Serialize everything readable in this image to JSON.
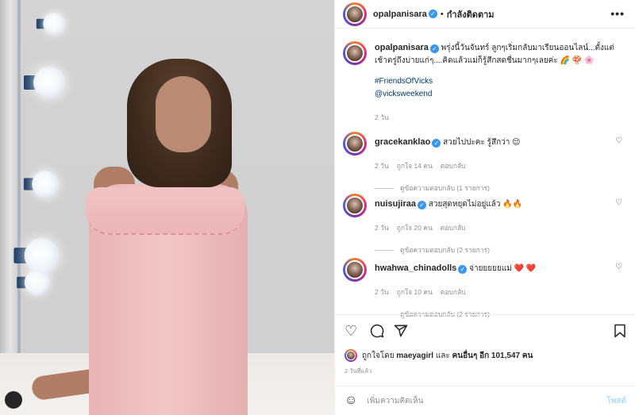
{
  "post": {
    "username": "opalpanisara",
    "follow_label": "กำลังติดตาม",
    "more_label": "•••"
  },
  "caption": {
    "username": "opalpanisara",
    "text": "พรุ่งนี้วันจันทร์ ลูกๆเริ่มกลับมาเรียนออนไลน์...ตั้งแต่เช้าตรู่ถึงบ่ายแก่ๆ....คิดแล้วแม่ก็รู้สึกสดชื่นมากๆเลยค่ะ 🌈 🍄 🌸",
    "hashtag": "#FriendsOfVicks",
    "mention": "@vicksweekend",
    "time": "2 วัน"
  },
  "comments": [
    {
      "username": "gracekanklao",
      "text": "สวยไปปะคะ รู้สึกว่า 😌",
      "time": "2 วัน",
      "likes": "ถูกใจ 14 คน",
      "reply": "ตอบกลับ",
      "view_replies": "ดูข้อความตอบกลับ (1 รายการ)"
    },
    {
      "username": "nuisujiraa",
      "text": "สวยสุดหยุดไม่อยู่แล้ว 🔥🔥",
      "time": "2 วัน",
      "likes": "ถูกใจ 20 คน",
      "reply": "ตอบกลับ",
      "view_replies": "ดูข้อความตอบกลับ (2 รายการ)"
    },
    {
      "username": "hwahwa_chinadolls",
      "text": "จ่ายยยยยแม่ ❤️ ❤️",
      "time": "2 วัน",
      "likes": "ถูกใจ 10 คน",
      "reply": "ตอบกลับ",
      "view_replies": "ดูข้อความตอบกลับ (2 รายการ)"
    }
  ],
  "likes_line": {
    "prefix": "ถูกใจโดย",
    "user": "maeyagirl",
    "and": "และ",
    "others": "คนอื่นๆ อีก 101,547 คน"
  },
  "post_time": "2 วันที่แล้ว",
  "comment_box": {
    "placeholder": "เพิ่มความคิดเห็น",
    "post_label": "โพสต์"
  },
  "icons": {
    "heart": "heart-icon",
    "comment": "comment-icon",
    "share": "share-icon",
    "save": "bookmark-icon",
    "emoji": "emoji-icon",
    "more": "more-icon"
  },
  "colors": {
    "verified": "#3897f0",
    "link": "#00376b",
    "meta": "#8e8e8e",
    "post_button": "#b2dffc"
  }
}
